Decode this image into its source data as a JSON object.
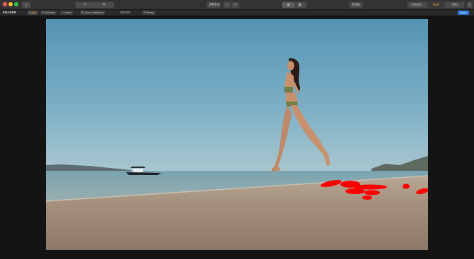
{
  "toolbar": {
    "zoom_label": "24%",
    "zoom_out": "−",
    "zoom_in": "+",
    "tools_label": "Tools",
    "tabs": [
      "Library",
      "Edit",
      "Info"
    ],
    "active_tab": "Edit",
    "done_label": "Done"
  },
  "eraser": {
    "panel_title": "ERASER",
    "add_label": "Add",
    "subtract_label": "Subtract",
    "lasso_label": "Lasso",
    "clear_label": "Clear Selection",
    "size_label": "Size:",
    "size_value": "20",
    "erase_label": "Erase"
  },
  "colors": {
    "accent": "#e39a2e",
    "done_blue": "#2f7bd9",
    "selection_red": "#ff0000"
  }
}
